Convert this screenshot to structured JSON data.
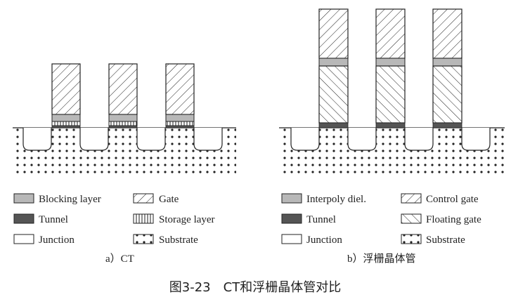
{
  "panel_a": {
    "caption": "a）CT",
    "legend": {
      "blocking_layer": "Blocking layer",
      "gate": "Gate",
      "tunnel": "Tunnel",
      "storage_layer": "Storage layer",
      "junction": "Junction",
      "substrate": "Substrate"
    }
  },
  "panel_b": {
    "caption": "b）浮栅晶体管",
    "legend": {
      "interpoly": "Interpoly diel.",
      "control_gate": "Control gate",
      "tunnel": "Tunnel",
      "floating_gate": "Floating gate",
      "junction": "Junction",
      "substrate": "Substrate"
    }
  },
  "figure_caption": "图3-23　CT和浮栅晶体管对比",
  "colors": {
    "gray_layer": "#b8b8b8",
    "tunnel": "#555555",
    "line": "#222222",
    "background": "#ffffff"
  }
}
